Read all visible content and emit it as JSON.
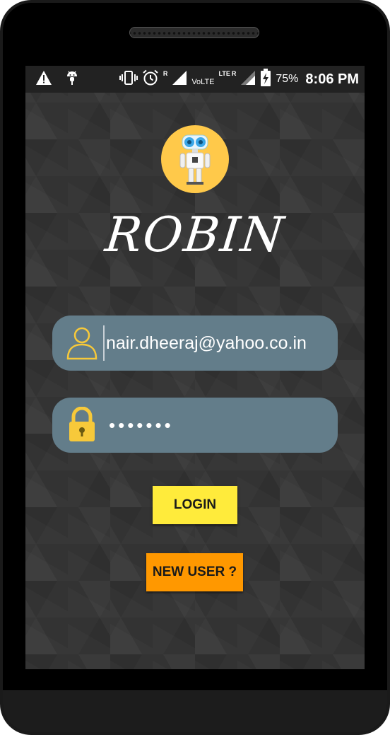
{
  "status_bar": {
    "icons": [
      "warning-icon",
      "android-debug-icon",
      "vibrate-icon",
      "alarm-icon",
      "signal-icon",
      "signal-icon",
      "battery-charging-icon"
    ],
    "roaming_label_1": "R",
    "volte_label": "VoLTE",
    "lte_label": "LTE",
    "roaming_label_2": "R",
    "battery_percent": "75%",
    "time": "8:06 PM"
  },
  "app": {
    "logo_icon": "robot-icon",
    "title": "ROBIN"
  },
  "login_form": {
    "email_icon": "user-outline-icon",
    "email_value": "nair.dheeraj@yahoo.co.in",
    "password_icon": "padlock-icon",
    "password_value": "•••••••",
    "login_label": "LOGIN",
    "new_user_label": "NEW USER ?"
  },
  "colors": {
    "field_bg": "#637d8a",
    "login_button": "#ffeb3b",
    "new_user_button": "#ff9800",
    "logo_bg": "#ffc94a",
    "screen_bg": "#333333"
  }
}
